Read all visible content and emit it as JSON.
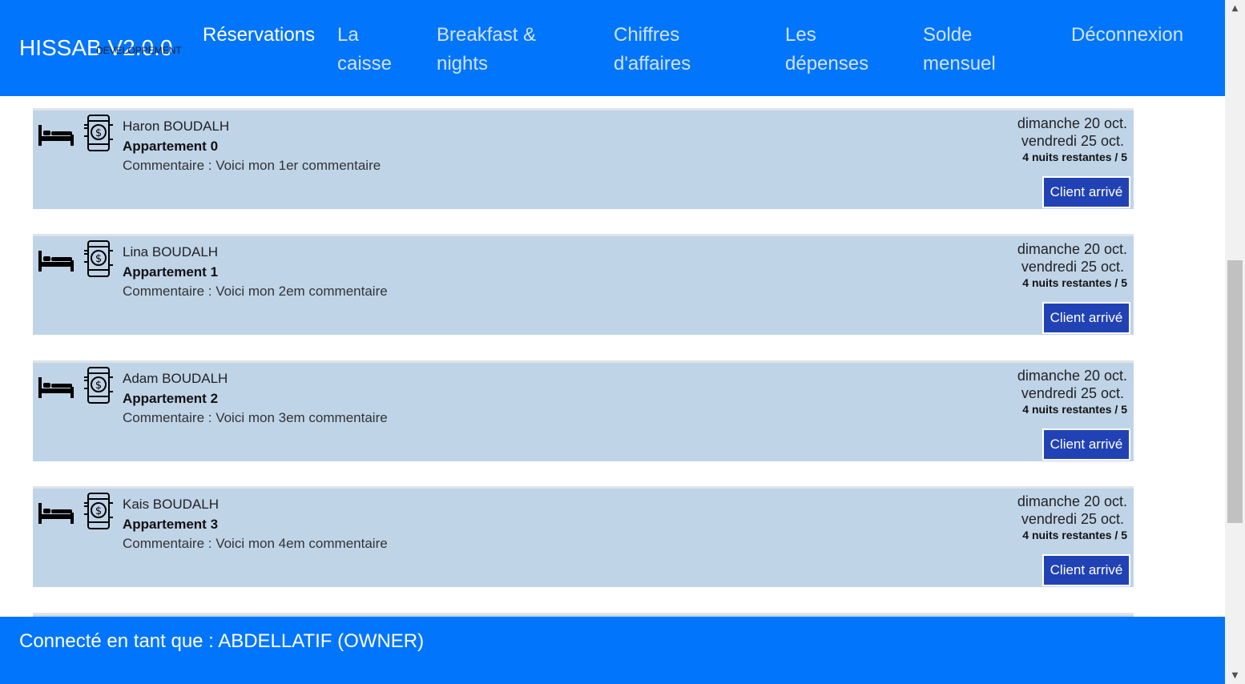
{
  "header": {
    "brand": "HISSAB V2.0.0",
    "brand_sub": "DEVELOPPEMENT",
    "nav": [
      {
        "label": "Réservations",
        "active": true
      },
      {
        "label": "La caisse"
      },
      {
        "label": "Breakfast & nights"
      },
      {
        "label": "Chiffres d'affaires"
      },
      {
        "label": "Les dépenses"
      },
      {
        "label": "Solde mensuel"
      },
      {
        "label": "Déconnexion"
      }
    ]
  },
  "reservations": [
    {
      "client": "Haron BOUDALH",
      "apartment": "Appartement 0",
      "comment": "Commentaire : Voici mon 1er commentaire",
      "date_from": "dimanche 20 oct.",
      "date_to": "vendredi 25 oct.",
      "nights": "4 nuits restantes / 5",
      "button": "Client arrivé"
    },
    {
      "client": "Lina BOUDALH",
      "apartment": "Appartement 1",
      "comment": "Commentaire : Voici mon 2em commentaire",
      "date_from": "dimanche 20 oct.",
      "date_to": "vendredi 25 oct.",
      "nights": "4 nuits restantes / 5",
      "button": "Client arrivé"
    },
    {
      "client": "Adam BOUDALH",
      "apartment": "Appartement 2",
      "comment": "Commentaire : Voici mon 3em commentaire",
      "date_from": "dimanche 20 oct.",
      "date_to": "vendredi 25 oct.",
      "nights": "4 nuits restantes / 5",
      "button": "Client arrivé"
    },
    {
      "client": "Kais BOUDALH",
      "apartment": "Appartement 3",
      "comment": "Commentaire : Voici mon 4em commentaire",
      "date_from": "dimanche 20 oct.",
      "date_to": "vendredi 25 oct.",
      "nights": "4 nuits restantes / 5",
      "button": "Client arrivé"
    }
  ],
  "icons": {
    "stay": "bed-icon",
    "payment": "mobile-payment-icon"
  },
  "footer": {
    "text": "Connecté en tant que : ABDELLATIF (OWNER)"
  },
  "colors": {
    "primary": "#0275fd",
    "card_bg": "#c0d4e8",
    "button_bg": "#2142b4"
  }
}
